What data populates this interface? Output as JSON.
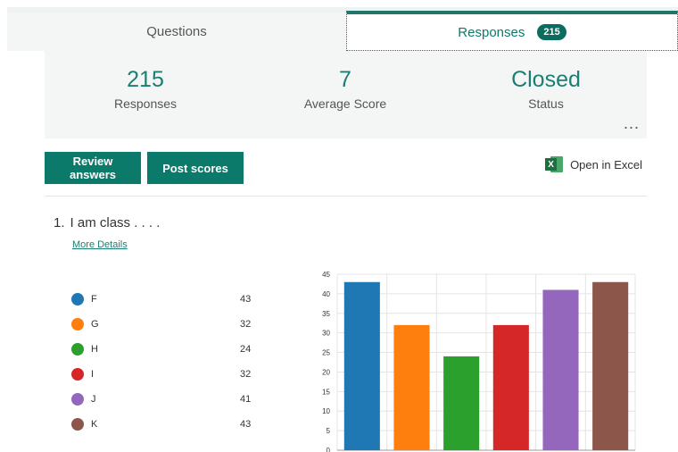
{
  "tabs": {
    "questions_label": "Questions",
    "responses_label": "Responses",
    "responses_badge": "215"
  },
  "summary": {
    "responses_value": "215",
    "responses_label": "Responses",
    "avg_value": "7",
    "avg_label": "Average Score",
    "status_value": "Closed",
    "status_label": "Status",
    "more_label": "..."
  },
  "actions": {
    "review_label": "Review answers",
    "post_label": "Post scores",
    "excel_label": "Open in Excel",
    "excel_icon_text": "X"
  },
  "question": {
    "number": "1.",
    "text": "I am class . . . .",
    "details_link": "More Details"
  },
  "legend": [
    {
      "label": "F",
      "value": "43",
      "color": "#1f77b4"
    },
    {
      "label": "G",
      "value": "32",
      "color": "#ff7f0e"
    },
    {
      "label": "H",
      "value": "24",
      "color": "#2ca02c"
    },
    {
      "label": "I",
      "value": "32",
      "color": "#d62728"
    },
    {
      "label": "J",
      "value": "41",
      "color": "#9467bd"
    },
    {
      "label": "K",
      "value": "43",
      "color": "#8c564b"
    }
  ],
  "chart_data": {
    "type": "bar",
    "categories": [
      "F",
      "G",
      "H",
      "I",
      "J",
      "K"
    ],
    "values": [
      43,
      32,
      24,
      32,
      41,
      43
    ],
    "colors": [
      "#1f77b4",
      "#ff7f0e",
      "#2ca02c",
      "#d62728",
      "#9467bd",
      "#8c564b"
    ],
    "ylim": [
      0,
      45
    ],
    "yticks": [
      0,
      5,
      10,
      15,
      20,
      25,
      30,
      35,
      40,
      45
    ],
    "grid": true
  }
}
